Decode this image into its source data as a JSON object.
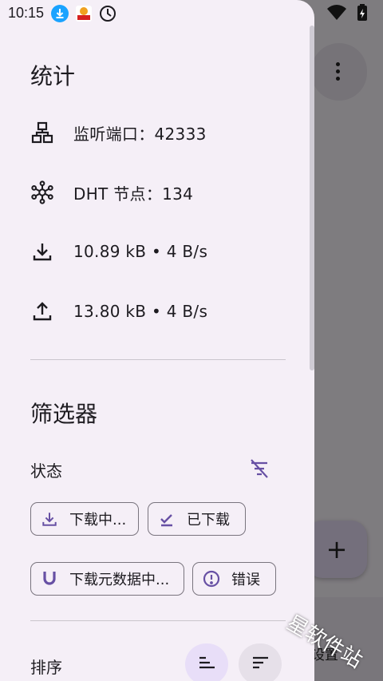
{
  "status_bar": {
    "time": "10:15",
    "icons": [
      "download-notification-icon",
      "app-notification-icon",
      "clock-icon",
      "wifi-icon",
      "battery-charging-icon"
    ]
  },
  "background": {
    "nav_label": "设置",
    "fab_symbol": "+"
  },
  "drawer": {
    "stats": {
      "title": "统计",
      "port": "监听端口：42333",
      "dht": "DHT 节点：134",
      "download": "10.89 kB • 4 B/s",
      "upload": "13.80 kB • 4 B/s"
    },
    "filters": {
      "title": "筛选器",
      "status_label": "状态",
      "chips": {
        "downloading": "下载中...",
        "downloaded": "已下载",
        "metadata": "下载元数据中...",
        "error": "错误"
      }
    },
    "sort": {
      "label": "排序"
    }
  },
  "watermark": "星软件站",
  "colors": {
    "accent": "#6750a4",
    "drawer_bg": "#f5eff7",
    "sort_selected": "#e8def8"
  }
}
